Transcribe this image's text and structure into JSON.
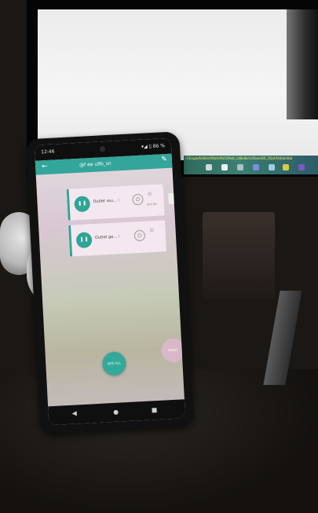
{
  "status_bar": {
    "time": "12:46",
    "icons": "▾◢ ▯ 86 %"
  },
  "app_bar": {
    "title": "@f ee u9b_sn"
  },
  "cards": [
    {
      "label": "Outlet ssu...  ⁝",
      "sub": "sco de"
    },
    {
      "label": "Outlet ge...  ⁝",
      "sub": ""
    }
  ],
  "fab": {
    "main_label": "ADD ALL",
    "secondary_label": "RESET"
  },
  "monitor": {
    "url_text": "/{Single/6484/cf/6b0cf6e5/Mult_cd8e8b/cb5be/e80_35b4/fd4bb/4bb"
  },
  "colors": {
    "accent": "#33a59a",
    "card_bg": "#f4e7ef"
  }
}
